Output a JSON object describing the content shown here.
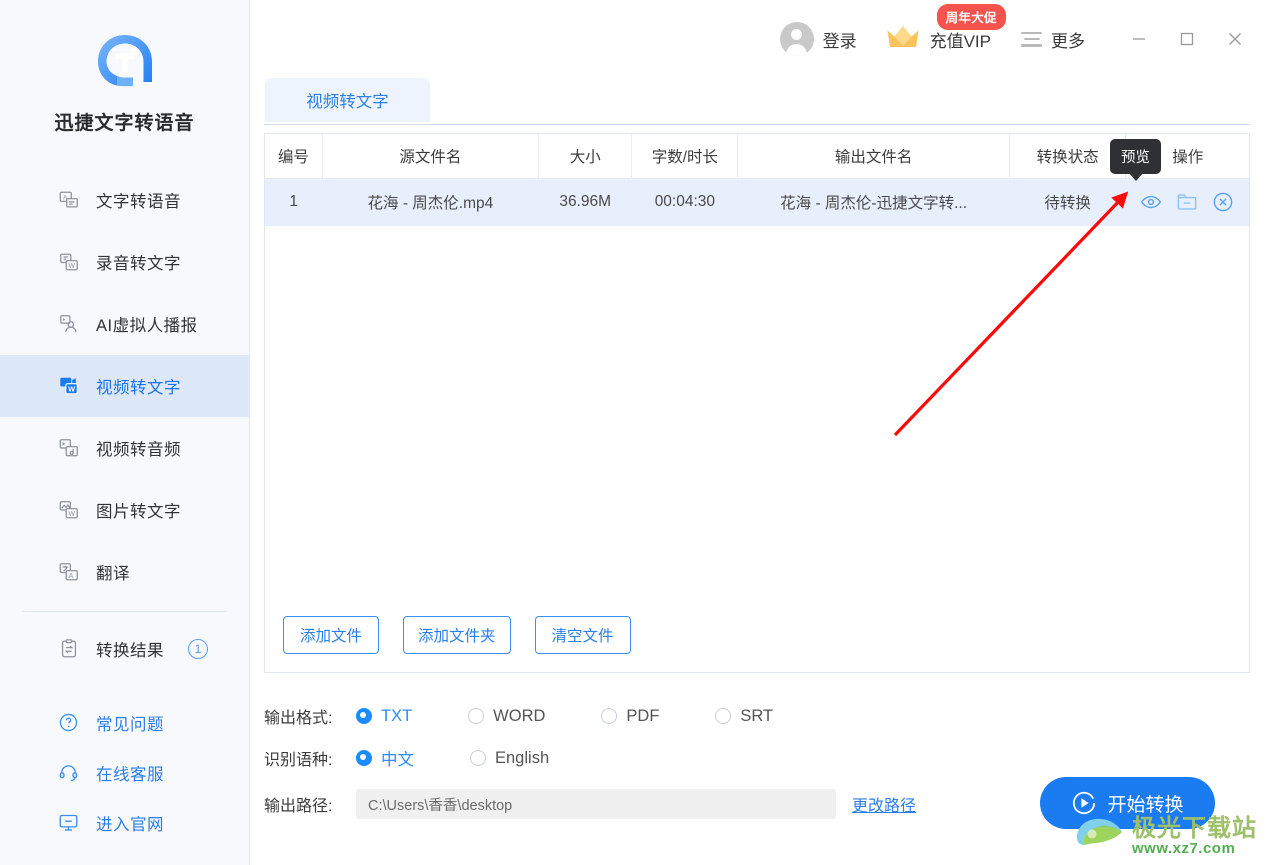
{
  "app": {
    "brand_name": "迅捷文字转语音",
    "logo_icon": "app-logo-icon"
  },
  "sidebar": {
    "items": [
      {
        "label": "文字转语音",
        "icon": "text-to-speech-icon",
        "active": false
      },
      {
        "label": "录音转文字",
        "icon": "audio-to-text-icon",
        "active": false
      },
      {
        "label": "AI虚拟人播报",
        "icon": "ai-avatar-icon",
        "active": false
      },
      {
        "label": "视频转文字",
        "icon": "video-to-text-icon",
        "active": true
      },
      {
        "label": "视频转音频",
        "icon": "video-to-audio-icon",
        "active": false
      },
      {
        "label": "图片转文字",
        "icon": "image-to-text-icon",
        "active": false
      },
      {
        "label": "翻译",
        "icon": "translate-icon",
        "active": false
      }
    ],
    "results": {
      "label": "转换结果",
      "count": "1",
      "icon": "clipboard-icon"
    },
    "links": [
      {
        "label": "常见问题",
        "icon": "question-circle-icon"
      },
      {
        "label": "在线客服",
        "icon": "headset-icon"
      },
      {
        "label": "进入官网",
        "icon": "monitor-icon"
      }
    ]
  },
  "header": {
    "login": {
      "label": "登录",
      "icon": "user-avatar-icon"
    },
    "vip": {
      "label": "充值VIP",
      "icon": "crown-icon",
      "badge": "周年大促"
    },
    "more": {
      "label": "更多",
      "icon": "hamburger-icon"
    },
    "window": {
      "minimize": "minimize-icon",
      "maximize": "maximize-icon",
      "close": "close-icon"
    }
  },
  "tabs": [
    {
      "label": "视频转文字",
      "active": true
    }
  ],
  "table": {
    "columns": [
      "编号",
      "源文件名",
      "大小",
      "字数/时长",
      "输出文件名",
      "转换状态",
      "操作"
    ],
    "rows": [
      {
        "id": "1",
        "source_name": "花海 - 周杰伦.mp4",
        "size": "36.96M",
        "duration": "00:04:30",
        "output_name": "花海 - 周杰伦-迅捷文字转...",
        "status": "待转换",
        "ops": [
          "preview-eye-icon",
          "open-folder-icon",
          "remove-circle-icon"
        ]
      }
    ],
    "tooltip": "预览"
  },
  "panel_buttons": [
    {
      "label": "添加文件"
    },
    {
      "label": "添加文件夹"
    },
    {
      "label": "清空文件"
    }
  ],
  "options": {
    "format": {
      "label": "输出格式:",
      "choices": [
        {
          "label": "TXT",
          "selected": true
        },
        {
          "label": "WORD",
          "selected": false
        },
        {
          "label": "PDF",
          "selected": false
        },
        {
          "label": "SRT",
          "selected": false
        }
      ]
    },
    "language": {
      "label": "识别语种:",
      "choices": [
        {
          "label": "中文",
          "selected": true
        },
        {
          "label": "English",
          "selected": false
        }
      ]
    },
    "path": {
      "label": "输出路径:",
      "value": "C:\\Users\\香香\\desktop",
      "placeholder": "C:\\Users\\香香\\desktop",
      "change_link": "更改路径"
    }
  },
  "start_button": {
    "label": "开始转换",
    "icon": "play-circle-icon"
  },
  "watermark": {
    "cn": "极光下载站",
    "url": "www.xz7.com"
  },
  "colors": {
    "accent": "#1a7cf0",
    "link": "#2a7fe8",
    "sidebar_bg": "#f7f9fd",
    "active_nav_bg": "#dce7f8",
    "row_bg": "#e8effc",
    "badge_red": "#f5534e",
    "tooltip_bg": "#2f3033",
    "annotation_red": "#fa0a0a"
  }
}
